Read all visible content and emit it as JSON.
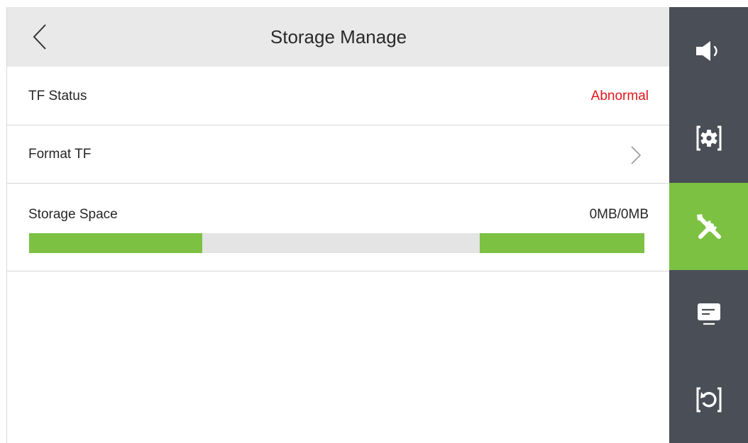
{
  "header": {
    "title": "Storage Manage",
    "back_icon": "chevron-left-icon"
  },
  "rows": {
    "tf_status": {
      "label": "TF Status",
      "value": "Abnormal",
      "value_color": "#e0161b"
    },
    "format_tf": {
      "label": "Format TF",
      "icon": "chevron-right-icon"
    },
    "storage_space": {
      "label": "Storage Space",
      "value": "0MB/0MB",
      "usage_segments_percent": [
        28.2,
        26.8
      ]
    }
  },
  "sidenav": {
    "items": [
      {
        "icon": "speaker-icon",
        "active": false
      },
      {
        "icon": "gear-icon",
        "active": false
      },
      {
        "icon": "tools-icon",
        "active": true
      },
      {
        "icon": "message-icon",
        "active": false
      },
      {
        "icon": "restore-icon",
        "active": false
      }
    ]
  },
  "colors": {
    "accent": "#7cc142",
    "sidebar": "#4a4e57",
    "header_bg": "#e9e9e9",
    "alert": "#e0161b"
  }
}
